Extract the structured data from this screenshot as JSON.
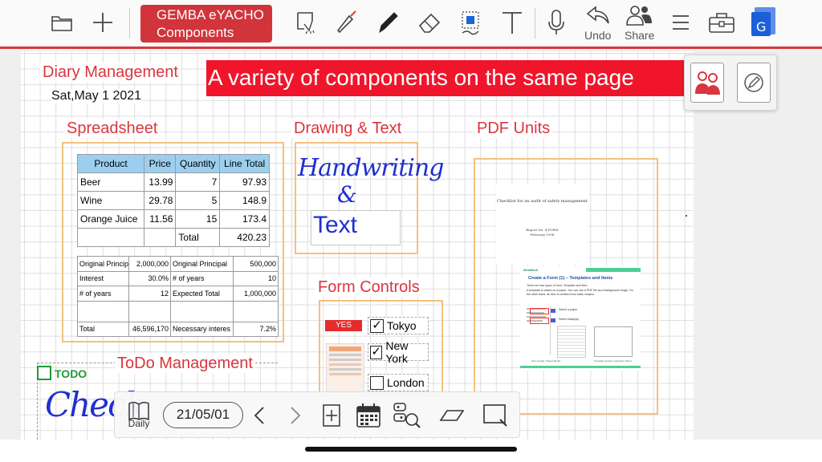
{
  "toolbar": {
    "app_title_line1": "GEMBA eYACHO",
    "app_title_line2": "Components",
    "undo_label": "Undo",
    "share_label": "Share",
    "accent_color": "#d9363e",
    "icons": [
      "folder-icon",
      "plus-icon",
      "lasso-icon",
      "laser-pointer-icon",
      "pen-icon",
      "eraser-icon",
      "shape-select-icon",
      "text-icon",
      "microphone-icon",
      "undo-icon",
      "share-icon",
      "menu-icon",
      "toolbox-icon",
      "google-docs-icon"
    ]
  },
  "page": {
    "banner": "A variety of components on the same page",
    "diary_title": "Diary Management",
    "date": "Sat,May 1 2021",
    "spreadsheet_label": "Spreadsheet",
    "drawing_label": "Drawing & Text",
    "pdf_label": "PDF Units",
    "form_label": "Form Controls",
    "todo_label": "ToDo Management",
    "todo_tag": "TODO",
    "handwriting_word": "Handwriting",
    "handwriting_amp": "&",
    "text_box": "Text",
    "handwriting_check": "Check"
  },
  "spreadsheet": {
    "headers": [
      "Product",
      "Price",
      "Quantity",
      "Line Total"
    ],
    "rows": [
      [
        "Beer",
        "13.99",
        "7",
        "97.93"
      ],
      [
        "Wine",
        "29.78",
        "5",
        "148.9"
      ],
      [
        "Orange Juice",
        "11.56",
        "15",
        "173.4"
      ]
    ],
    "total_label": "Total",
    "total_value": "420.23",
    "loan_rows": [
      [
        "Original Principa",
        "2,000,000",
        "Original Principal",
        "500,000"
      ],
      [
        "Interest",
        "30.0%",
        "# of years",
        "10"
      ],
      [
        "# of years",
        "12",
        "Expected Total",
        "1,000,000"
      ],
      [
        "Total",
        "46,596,170",
        "Necessary interes",
        "7.2%"
      ]
    ]
  },
  "pdf": {
    "page1_title": "Checklist for an audit of safety management",
    "page1_sub1": "Report No. 4 FORM",
    "page1_sub2": "February 1998",
    "page2_brand": "MetaMoJi",
    "page2_title": "Create a Form (1) – Templates and Items",
    "page2_body1": "There are two types of form, Template and Item.",
    "page2_body2": "A template is based on a paper. You can use a PDF file as a background image. On the other hand, an item is created from basic shapes.",
    "page2_step1": "Select a paper",
    "page2_step2": "Select shape(s)",
    "page2_cap1": "Item sample: Project Board",
    "page2_cap2": "Template sample: Inspection Sheet"
  },
  "form": {
    "yes_badge": "YES",
    "options": [
      {
        "label": "Tokyo",
        "checked": true
      },
      {
        "label": "New York",
        "checked": true
      },
      {
        "label": "London",
        "checked": false
      }
    ]
  },
  "bottom": {
    "daily_label": "Daily",
    "date_value": "21/05/01"
  }
}
